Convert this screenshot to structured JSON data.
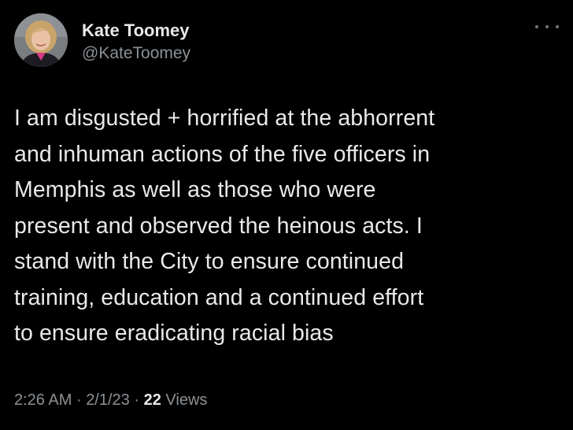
{
  "tweet": {
    "display_name": "Kate Toomey",
    "handle": "@KateToomey",
    "text_lines": [
      "I am disgusted + horrified at the abhorrent",
      "and inhuman actions of the five officers in",
      "Memphis as well as those who were",
      "present and observed the heinous acts. I",
      "stand with the City to ensure continued",
      "training, education and a continued effort",
      "to ensure eradicating racial bias"
    ],
    "time": "2:26 AM",
    "separator": "·",
    "date": "2/1/23",
    "views_count": "22",
    "views_label": "Views"
  },
  "icons": {
    "more": "more-options-icon",
    "avatar": "profile-photo"
  },
  "colors": {
    "background": "#000000",
    "primary_text": "#e7e9ea",
    "secondary_text": "#8b9196"
  }
}
